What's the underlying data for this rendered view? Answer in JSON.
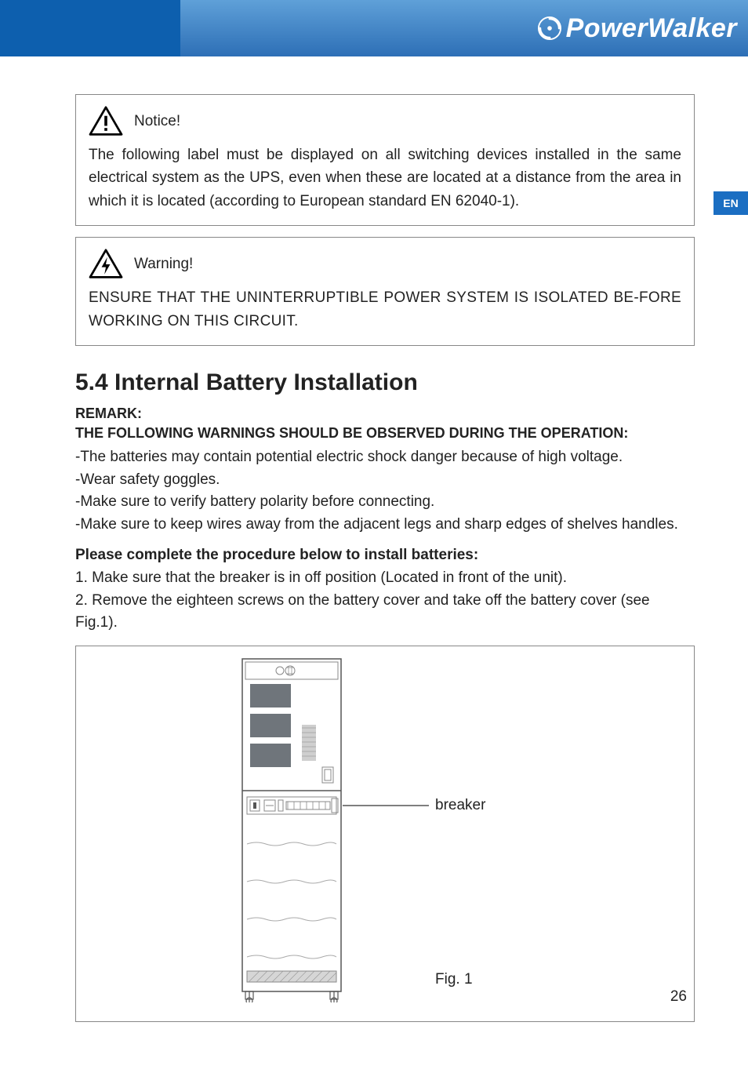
{
  "brand": {
    "name": "PowerWalker"
  },
  "langTab": "EN",
  "notice": {
    "title": "Notice!",
    "body": "The following label must be displayed on all switching devices installed in the same electrical system as the UPS, even when these are located at a distance from the area in which it is located (according to European standard EN 62040-1)."
  },
  "warning": {
    "title": "Warning!",
    "body": "ENSURE THAT THE UNINTERRUPTIBLE POWER SYSTEM IS ISOLATED BE-FORE WORKING ON THIS CIRCUIT."
  },
  "section": {
    "heading": "5.4 Internal Battery Installation",
    "remarkLabel": "REMARK:",
    "remarkHeading": "THE FOLLOWING WARNINGS SHOULD BE OBSERVED DURING THE OPERATION:",
    "bullets": [
      "-The batteries may contain potential electric shock danger because of high voltage.",
      "-Wear safety goggles.",
      "-Make sure to verify battery polarity before connecting.",
      "-Make sure to keep wires away from the adjacent legs and sharp edges of shelves handles."
    ],
    "procHead": "Please complete the procedure below to install batteries:",
    "proc": [
      "1. Make sure that the breaker is in off position (Located in front of the unit).",
      "2. Remove the eighteen screws on the battery cover and take off the battery cover (see Fig.1)."
    ]
  },
  "figure": {
    "breakerLabel": "breaker",
    "caption": "Fig. 1"
  },
  "pageNumber": "26"
}
